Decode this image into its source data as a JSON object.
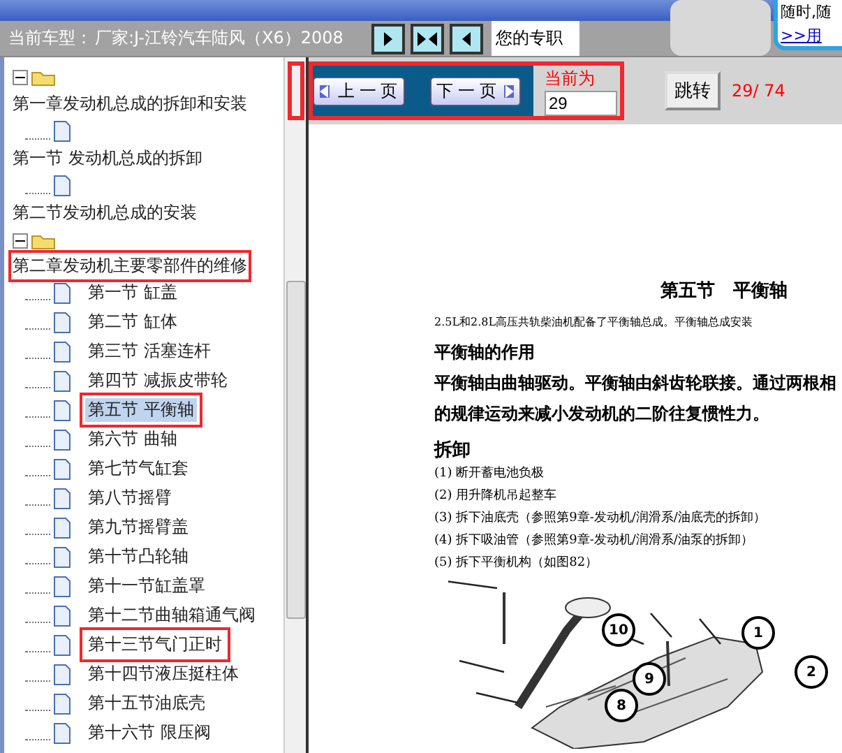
{
  "header": {
    "vehicle_label": "当前车型：",
    "vehicle": "厂家:J-江铃汽车陆风（X6）2008",
    "banner_text": "您的专职",
    "ad_text": "随时,随",
    "ad_link": ">>用"
  },
  "tree": [
    {
      "label": "第一章发动机总成的拆卸和安装",
      "expanded": true,
      "children": [
        {
          "label": "第一节 发动机总成的拆卸",
          "selected": false
        },
        {
          "label": "第二节发动机总成的安装",
          "selected": false
        }
      ]
    },
    {
      "label": "第二章发动机主要零部件的维修",
      "expanded": true,
      "marked": true,
      "children": [
        {
          "label": "第一节 缸盖",
          "selected": false
        },
        {
          "label": "第二节 缸体",
          "selected": false
        },
        {
          "label": "第三节 活塞连杆",
          "selected": false
        },
        {
          "label": "第四节 减振皮带轮",
          "selected": false
        },
        {
          "label": "第五节 平衡轴",
          "selected": true,
          "marked": true
        },
        {
          "label": "第六节 曲轴",
          "selected": false
        },
        {
          "label": "第七节气缸套",
          "selected": false
        },
        {
          "label": "第八节摇臂",
          "selected": false
        },
        {
          "label": "第九节摇臂盖",
          "selected": false
        },
        {
          "label": "第十节凸轮轴",
          "selected": false
        },
        {
          "label": "第十一节缸盖罩",
          "selected": false
        },
        {
          "label": "第十二节曲轴箱通气阀",
          "selected": false
        },
        {
          "label": "第十三节气门正时",
          "selected": false,
          "marked": true
        },
        {
          "label": "第十四节液压挺柱体",
          "selected": false
        },
        {
          "label": "第十五节油底壳",
          "selected": false
        },
        {
          "label": "第十六节 限压阀",
          "selected": false
        }
      ]
    }
  ],
  "pager": {
    "prev": "上 一 页",
    "next": "下 一 页",
    "current_label": "当前为",
    "page_value": "29",
    "jump": "跳转",
    "count": "29/ 74"
  },
  "document": {
    "title": "第五节　平衡轴",
    "intro": "2.5L和2.8L高压共轨柴油机配备了平衡轴总成。平衡轴总成安装",
    "heading1": "平衡轴的作用",
    "paragraph": "平衡轴由曲轴驱动。平衡轴由斜齿轮联接。通过两根相",
    "paragraph2": "的规律运动来减小发动机的二阶往复惯性力。",
    "heading2": "拆卸",
    "steps": [
      "(1) 断开蓄电池负极",
      "(2) 用升降机吊起整车",
      "(3) 拆下油底壳（参照第9章-发动机/润滑系/油底壳的拆卸）",
      "(4) 拆下吸油管（参照第9章-发动机/润滑系/油泵的拆卸）",
      "(5) 拆下平衡机构（如图82）"
    ],
    "callouts": [
      "10",
      "1",
      "9",
      "2",
      "8"
    ]
  }
}
